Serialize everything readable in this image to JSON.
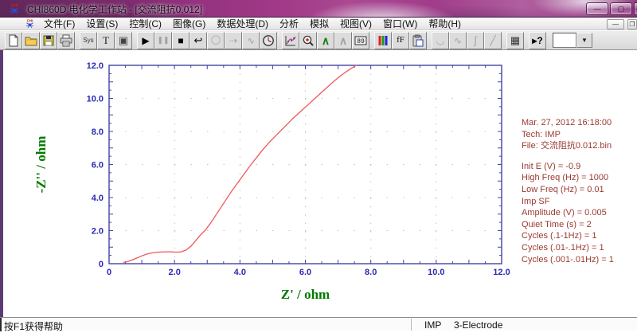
{
  "window": {
    "title": "CHI860D 电化学工作站 - [交流阻抗0.012]",
    "controls": {
      "minimize_glyph": "—",
      "maximize_glyph": "▢",
      "close_glyph": ""
    }
  },
  "menu": {
    "items": [
      "文件(F)",
      "设置(S)",
      "控制(C)",
      "图像(G)",
      "数据处理(D)",
      "分析",
      "模拟",
      "视图(V)",
      "窗口(W)",
      "帮助(H)"
    ],
    "mdi_minimize_glyph": "—",
    "mdi_restore_glyph": "❐"
  },
  "toolbar": {
    "items": [
      {
        "name": "new-file-button",
        "icon": "sym:page",
        "enabled": true
      },
      {
        "name": "open-file-button",
        "icon": "sym:folder",
        "enabled": true
      },
      {
        "name": "save-button",
        "icon": "sym:floppy",
        "enabled": true
      },
      {
        "name": "print-button",
        "icon": "sym:print",
        "enabled": true
      },
      {
        "name": "system-setup-button",
        "glyph": "Sys",
        "size": "8px",
        "color": "#333",
        "gap": true,
        "enabled": true
      },
      {
        "name": "text-tool-button",
        "glyph": "T",
        "size": "13px",
        "color": "#222",
        "serif": true,
        "enabled": true
      },
      {
        "name": "window-layout-button",
        "glyph": "▣",
        "size": "13px",
        "color": "#444",
        "enabled": true
      },
      {
        "name": "run-experiment-button",
        "glyph": "▶",
        "size": "12px",
        "color": "#000",
        "gap": true,
        "enabled": true
      },
      {
        "name": "pause-button",
        "glyph": "❚❚",
        "size": "9px",
        "color": "#a0a0a0",
        "enabled": false
      },
      {
        "name": "stop-button",
        "glyph": "■",
        "size": "12px",
        "color": "#000",
        "enabled": true
      },
      {
        "name": "reverse-scan-button",
        "glyph": "↩",
        "size": "13px",
        "color": "#000",
        "enabled": true
      },
      {
        "name": "cell-control-button",
        "glyph": "◯",
        "size": "11px",
        "color": "#a8a8a8",
        "enabled": false
      },
      {
        "name": "step-function-button",
        "glyph": "⇢",
        "size": "12px",
        "color": "#a8a8a8",
        "enabled": false
      },
      {
        "name": "wave-control-button",
        "glyph": "∿",
        "size": "12px",
        "color": "#a8a8a8",
        "enabled": false
      },
      {
        "name": "timer-button",
        "icon": "sym:timer",
        "enabled": true
      },
      {
        "name": "present-data-plot-button",
        "icon": "sym:chart",
        "gap": true,
        "enabled": true
      },
      {
        "name": "zoom-in-button",
        "icon": "sym:zoom",
        "enabled": true
      },
      {
        "name": "peak-analysis-button",
        "glyph": "∧",
        "size": "14px",
        "color": "#157a15",
        "bold": true,
        "enabled": true
      },
      {
        "name": "peak-gray-button",
        "glyph": "∧",
        "size": "14px",
        "color": "#a8a8a8",
        "bold": true,
        "enabled": false
      },
      {
        "name": "data-readout-button",
        "icon": "sym:digits",
        "enabled": true
      },
      {
        "name": "color-legend-button",
        "icon": "sym:rgb",
        "gap": true,
        "enabled": true
      },
      {
        "name": "font-button",
        "glyph": "fF",
        "size": "11px",
        "color": "#111",
        "serif": true,
        "enabled": true
      },
      {
        "name": "copy-to-clipboard-button",
        "icon": "sym:clip",
        "enabled": true
      },
      {
        "name": "smoothing-button",
        "glyph": "◡",
        "size": "12px",
        "color": "#a8a8a8",
        "gap": true,
        "enabled": false
      },
      {
        "name": "derivative-button",
        "glyph": "∿",
        "size": "12px",
        "color": "#a8a8a8",
        "enabled": false
      },
      {
        "name": "integration-button",
        "glyph": "∫",
        "size": "13px",
        "color": "#a8a8a8",
        "enabled": false
      },
      {
        "name": "baseline-button",
        "glyph": "╱",
        "size": "12px",
        "color": "#a8a8a8",
        "enabled": false
      },
      {
        "name": "data-grid-button",
        "glyph": "▦",
        "size": "13px",
        "color": "#333",
        "gap": true,
        "enabled": true
      },
      {
        "name": "context-help-button",
        "glyph": "▸?",
        "size": "12px",
        "color": "#000",
        "bold": true,
        "gap": true,
        "enabled": true
      }
    ],
    "scale_combo": {
      "value": "",
      "arrow_glyph": "▼"
    }
  },
  "chart_data": {
    "type": "line",
    "title": "",
    "xlabel": "Z' / ohm",
    "ylabel": "-Z'' / ohm",
    "xlim": [
      0,
      12
    ],
    "ylim": [
      0,
      12
    ],
    "x_tick_labels": [
      "0",
      "2.0",
      "4.0",
      "6.0",
      "8.0",
      "10.0",
      "12.0"
    ],
    "y_tick_labels": [
      "0",
      "2.0",
      "4.0",
      "6.0",
      "8.0",
      "10.0",
      "12.0"
    ],
    "major_tick_step": 2,
    "mid_tick_step": 1,
    "minor_tick_step": 0.5,
    "grid": "dotted-at-major",
    "legend": "none",
    "colors": {
      "frame": "#4343a5",
      "tick_label": "#2a2ab5",
      "axis_title": "#007a00",
      "grid_dot": "#c8c89a",
      "curve": "#f0575a"
    },
    "series": [
      {
        "name": "impedance-curve",
        "points": [
          [
            0.45,
            0.08
          ],
          [
            0.55,
            0.12
          ],
          [
            0.7,
            0.22
          ],
          [
            0.85,
            0.34
          ],
          [
            1.0,
            0.47
          ],
          [
            1.15,
            0.58
          ],
          [
            1.3,
            0.65
          ],
          [
            1.5,
            0.7
          ],
          [
            1.7,
            0.72
          ],
          [
            1.9,
            0.72
          ],
          [
            2.05,
            0.7
          ],
          [
            2.2,
            0.72
          ],
          [
            2.35,
            0.82
          ],
          [
            2.5,
            1.05
          ],
          [
            2.65,
            1.4
          ],
          [
            2.8,
            1.75
          ],
          [
            2.95,
            2.05
          ],
          [
            3.1,
            2.45
          ],
          [
            3.3,
            3.05
          ],
          [
            3.5,
            3.65
          ],
          [
            3.7,
            4.25
          ],
          [
            3.9,
            4.8
          ],
          [
            4.1,
            5.35
          ],
          [
            4.3,
            5.9
          ],
          [
            4.5,
            6.4
          ],
          [
            4.7,
            6.9
          ],
          [
            4.9,
            7.35
          ],
          [
            5.1,
            7.75
          ],
          [
            5.35,
            8.25
          ],
          [
            5.6,
            8.75
          ],
          [
            5.85,
            9.2
          ],
          [
            6.1,
            9.65
          ],
          [
            6.35,
            10.1
          ],
          [
            6.6,
            10.55
          ],
          [
            6.85,
            11.0
          ],
          [
            7.1,
            11.4
          ],
          [
            7.35,
            11.75
          ],
          [
            7.55,
            12.0
          ]
        ]
      }
    ]
  },
  "info_panel": {
    "text_color": "#9a3a30",
    "header": [
      "Mar. 27, 2012  16:18:00",
      "Tech: IMP",
      "File: 交流阻抗0.012.bin"
    ],
    "params": [
      "Init E (V) = -0.9",
      "High Freq (Hz) = 1000",
      "Low Freq (Hz) = 0.01",
      "Imp SF",
      "Amplitude (V) = 0.005",
      "Quiet Time (s) = 2",
      "Cycles (.1-1Hz) = 1",
      "Cycles (.01-.1Hz) = 1",
      "Cycles (.001-.01Hz) = 1"
    ]
  },
  "status_bar": {
    "help_text": "按F1获得帮助",
    "technique": "IMP",
    "electrode": "3-Electrode"
  }
}
